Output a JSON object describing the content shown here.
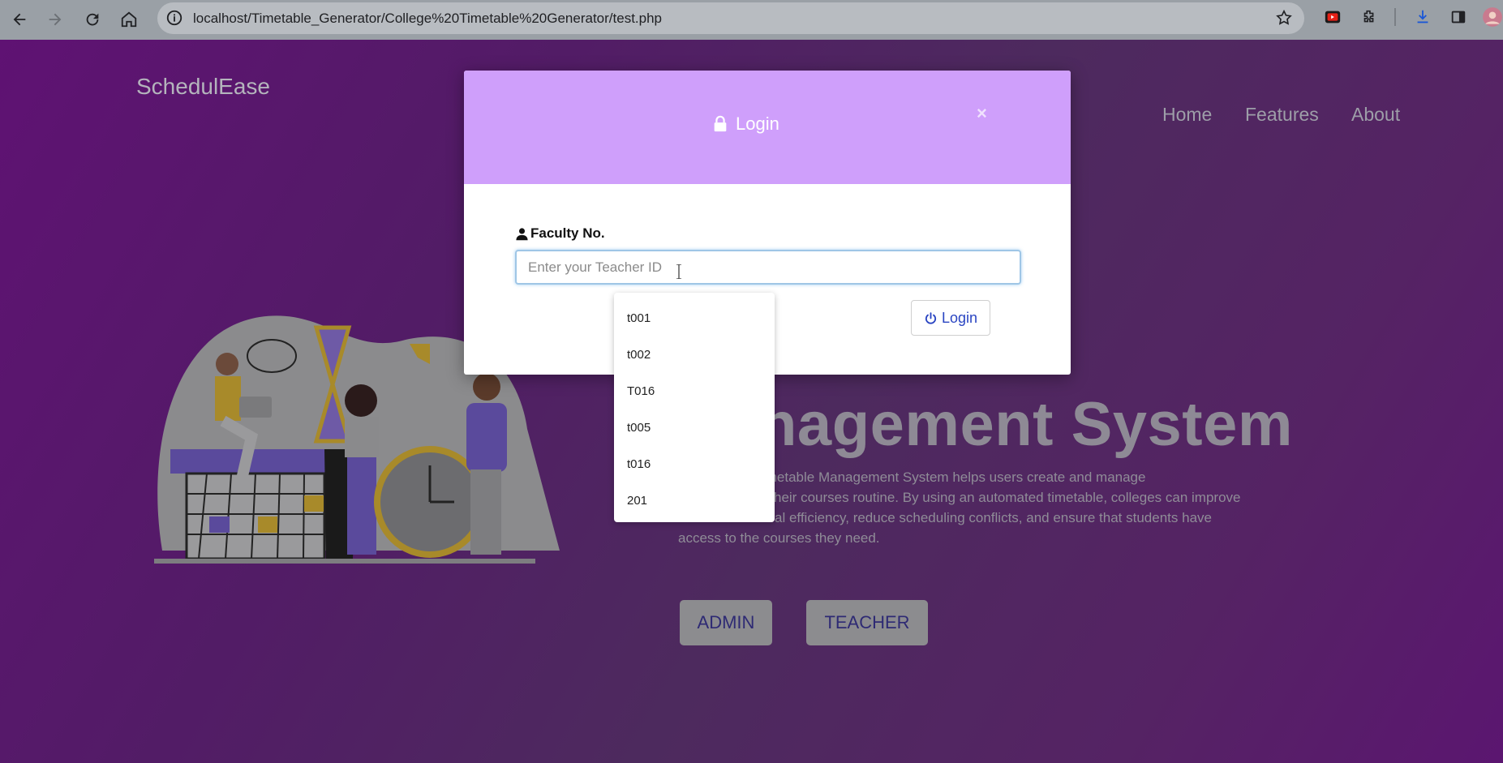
{
  "browser": {
    "url": "localhost/Timetable_Generator/College%20Timetable%20Generator/test.php"
  },
  "site": {
    "brand": "SchedulEase",
    "nav": [
      "Home",
      "Features",
      "About"
    ],
    "hero_title": "nagement System",
    "hero_text_lines": [
      "nated timetable Management System helps users create and manage",
      "heir courses routine. By using an automated timetable, colleges can improve",
      "al efficiency, reduce scheduling conflicts, and ensure that students have",
      "access to the courses they need."
    ],
    "admin_label": "ADMIN",
    "teacher_label": "TEACHER"
  },
  "modal": {
    "title": "Login",
    "close": "×",
    "field_label": "Faculty No.",
    "input_placeholder": "Enter your Teacher ID",
    "login_button": "Login"
  },
  "suggestions": [
    "t001",
    "t002",
    "T016",
    "t005",
    "t016",
    "201"
  ],
  "colors": {
    "modal_header": "#cf9ffb",
    "page_bg": "#5a1a6c",
    "login_text": "#2a45c2"
  }
}
